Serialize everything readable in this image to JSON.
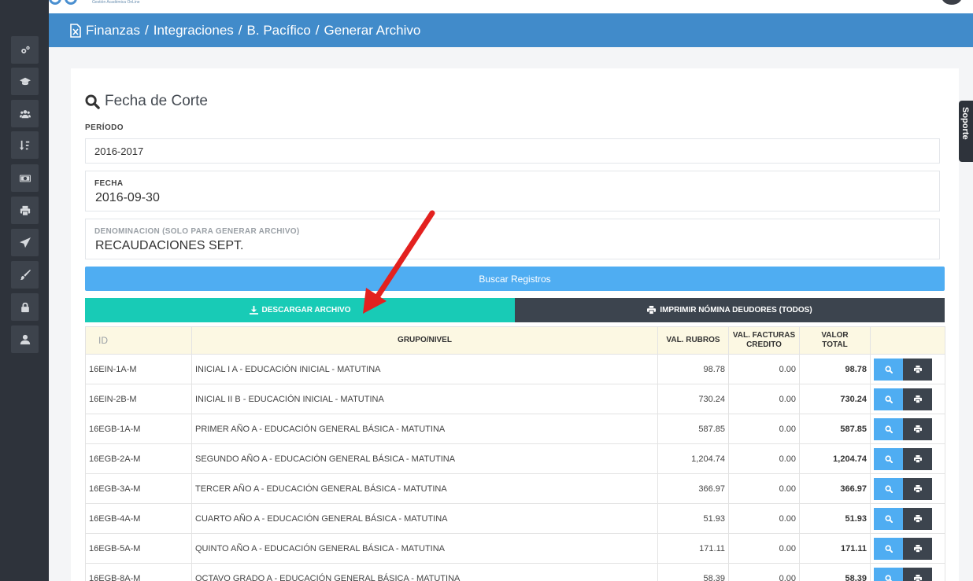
{
  "header": {
    "breadcrumb": [
      "Finanzas",
      "Integraciones",
      "B. Pacífico"
    ],
    "current": "Generar Archivo"
  },
  "logo_tagline": "Gestión Académica OnLine",
  "section_title": "Fecha de Corte",
  "periodo": {
    "label": "PERÍODO",
    "value": "2016-2017"
  },
  "fecha": {
    "label": "FECHA",
    "value": "2016-09-30"
  },
  "denominacion": {
    "label": "DENOMINACION (SOLO PARA GENERAR ARCHIVO)",
    "value": "RECAUDACIONES SEPT."
  },
  "buttons": {
    "buscar": "Buscar Registros",
    "descargar": "DESCARGAR ARCHIVO",
    "imprimir": "IMPRIMIR NÓMINA DEUDORES (TODOS)"
  },
  "soporte_label": "Soporte",
  "table": {
    "headers": {
      "id": "ID",
      "grupo": "GRUPO/NIVEL",
      "val_rubros": "VAL. RUBROS",
      "val_facturas_1": "VAL. FACTURAS",
      "val_facturas_2": "CREDITO",
      "valor_total_1": "VALOR",
      "valor_total_2": "TOTAL"
    },
    "rows": [
      {
        "id": "16EIN-1A-M",
        "grupo": "INICIAL I A - EDUCACIÓN INICIAL - MATUTINA",
        "val_rubros": "98.78",
        "val_facturas": "0.00",
        "valor_total": "98.78"
      },
      {
        "id": "16EIN-2B-M",
        "grupo": "INICIAL II B - EDUCACIÓN INICIAL - MATUTINA",
        "val_rubros": "730.24",
        "val_facturas": "0.00",
        "valor_total": "730.24"
      },
      {
        "id": "16EGB-1A-M",
        "grupo": "PRIMER AÑO A - EDUCACIÓN GENERAL BÁSICA - MATUTINA",
        "val_rubros": "587.85",
        "val_facturas": "0.00",
        "valor_total": "587.85"
      },
      {
        "id": "16EGB-2A-M",
        "grupo": "SEGUNDO AÑO A - EDUCACIÓN GENERAL BÁSICA - MATUTINA",
        "val_rubros": "1,204.74",
        "val_facturas": "0.00",
        "valor_total": "1,204.74"
      },
      {
        "id": "16EGB-3A-M",
        "grupo": "TERCER AÑO A - EDUCACIÓN GENERAL BÁSICA - MATUTINA",
        "val_rubros": "366.97",
        "val_facturas": "0.00",
        "valor_total": "366.97"
      },
      {
        "id": "16EGB-4A-M",
        "grupo": "CUARTO AÑO A - EDUCACIÓN GENERAL BÁSICA - MATUTINA",
        "val_rubros": "51.93",
        "val_facturas": "0.00",
        "valor_total": "51.93"
      },
      {
        "id": "16EGB-5A-M",
        "grupo": "QUINTO AÑO A - EDUCACIÓN GENERAL BÁSICA - MATUTINA",
        "val_rubros": "171.11",
        "val_facturas": "0.00",
        "valor_total": "171.11"
      },
      {
        "id": "16EGB-8A-M",
        "grupo": "OCTAVO GRADO A - EDUCACIÓN GENERAL BÁSICA - MATUTINA",
        "val_rubros": "58.39",
        "val_facturas": "0.00",
        "valor_total": "58.39"
      }
    ]
  },
  "sidebar": {
    "icons": [
      "cogs-icon",
      "graduation-cap-icon",
      "users-icon",
      "sort-icon",
      "money-icon",
      "print-icon",
      "send-icon",
      "brush-icon",
      "lock-icon",
      "user-icon"
    ]
  },
  "colors": {
    "header_blue": "#418bca",
    "sidebar_dark": "#2e333b",
    "buscar_blue": "#4fadf2",
    "descargar_teal": "#18cbb6",
    "imprimir_dark": "#3c444e",
    "table_header_bg": "#fcf8e3",
    "arrow_red": "#e3211f"
  }
}
